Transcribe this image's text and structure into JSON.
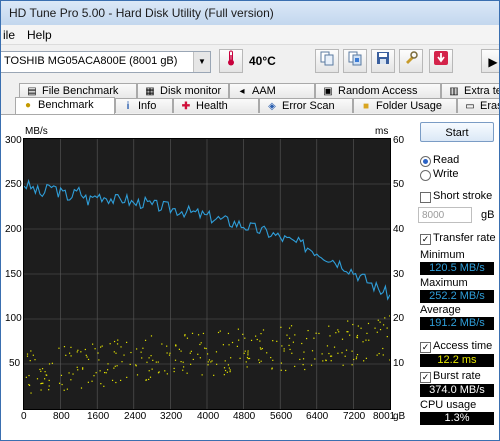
{
  "window": {
    "title": "HD Tune Pro 5.00 - Hard Disk Utility (Full version)"
  },
  "menu": {
    "items": [
      "ile",
      "Help"
    ]
  },
  "toolbar": {
    "drive_label": "TOSHIB MG05ACA800E (8001 gB)",
    "temperature": "40°C"
  },
  "tabs_row1": [
    {
      "label": "File Benchmark",
      "icon": "file-benchmark-icon"
    },
    {
      "label": "Disk monitor",
      "icon": "disk-monitor-icon"
    },
    {
      "label": "AAM",
      "icon": "speaker-icon"
    },
    {
      "label": "Random Access",
      "icon": "random-access-icon"
    },
    {
      "label": "Extra tests",
      "icon": "extra-tests-icon"
    }
  ],
  "tabs_row2": [
    {
      "label": "Benchmark",
      "icon": "benchmark-icon"
    },
    {
      "label": "Info",
      "icon": "info-icon"
    },
    {
      "label": "Health",
      "icon": "health-icon"
    },
    {
      "label": "Error Scan",
      "icon": "error-scan-icon"
    },
    {
      "label": "Folder Usage",
      "icon": "folder-icon"
    },
    {
      "label": "Erase",
      "icon": "erase-icon"
    }
  ],
  "panel": {
    "start_label": "Start",
    "read_label": "Read",
    "write_label": "Write",
    "short_stroke_label": "Short stroke",
    "stroke_value": "8000",
    "stroke_unit": "gB",
    "transfer_rate_label": "Transfer rate",
    "minimum_label": "Minimum",
    "minimum_value": "120.5 MB/s",
    "maximum_label": "Maximum",
    "maximum_value": "252.2 MB/s",
    "average_label": "Average",
    "average_value": "191.2 MB/s",
    "access_time_label": "Access time",
    "access_time_value": "12.2 ms",
    "burst_rate_label": "Burst rate",
    "burst_rate_value": "374.0 MB/s",
    "cpu_usage_label": "CPU usage",
    "cpu_usage_value": "1.3%"
  },
  "colors": {
    "transfer": "#2f9ed9",
    "access": "#e6e600",
    "plot_bg": "#1d1d1d",
    "grid": "#5a5a5a"
  },
  "chart_data": {
    "type": "line",
    "ylabel_left": "MB/s",
    "ylabel_right": "ms",
    "xlabel": "gB",
    "ylim_left": [
      0,
      300
    ],
    "ylim_right": [
      0,
      60
    ],
    "xlim": [
      0,
      8001
    ],
    "x_ticks": [
      "0",
      "800",
      "1600",
      "2400",
      "3200",
      "4000",
      "4800",
      "5600",
      "6400",
      "7200",
      "8001"
    ],
    "y_ticks_left": [
      "300",
      "250",
      "200",
      "150",
      "100",
      "50"
    ],
    "y_ticks_right": [
      "60",
      "50",
      "40",
      "30",
      "20",
      "10"
    ],
    "grid": true,
    "series": [
      {
        "name": "Transfer rate",
        "x": [
          0,
          200,
          400,
          600,
          800,
          1000,
          1200,
          1400,
          1600,
          1800,
          2000,
          2200,
          2400,
          2600,
          2800,
          3000,
          3200,
          3400,
          3600,
          3800,
          4000,
          4200,
          4400,
          4600,
          4800,
          5000,
          5200,
          5400,
          5600,
          5800,
          6000,
          6200,
          6400,
          6600,
          6800,
          7000,
          7200,
          7400,
          7600,
          7800,
          8001
        ],
        "values": [
          250,
          245,
          238,
          248,
          240,
          236,
          242,
          232,
          238,
          236,
          232,
          234,
          228,
          230,
          226,
          225,
          223,
          221,
          219,
          217,
          214,
          212,
          209,
          207,
          204,
          201,
          198,
          195,
          191,
          187,
          184,
          180,
          175,
          170,
          165,
          160,
          153,
          146,
          139,
          132,
          127
        ]
      },
      {
        "name": "Access time",
        "x": [
          0,
          800,
          1600,
          2400,
          3200,
          4000,
          4800,
          5600,
          6400,
          7200,
          8001
        ],
        "values": [
          8,
          9,
          10,
          11,
          12,
          12.5,
          13,
          13.5,
          14,
          15,
          16
        ]
      }
    ]
  }
}
